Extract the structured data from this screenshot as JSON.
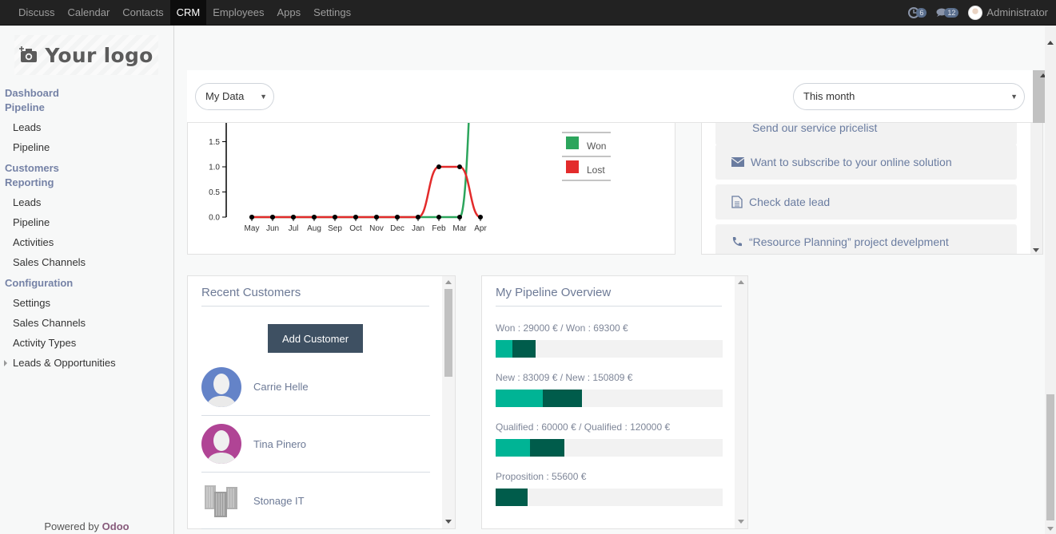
{
  "topbar": {
    "apps": [
      {
        "label": "Discuss",
        "active": false
      },
      {
        "label": "Calendar",
        "active": false
      },
      {
        "label": "Contacts",
        "active": false
      },
      {
        "label": "CRM",
        "active": true
      },
      {
        "label": "Employees",
        "active": false
      },
      {
        "label": "Apps",
        "active": false
      },
      {
        "label": "Settings",
        "active": false
      }
    ],
    "activity_count": "6",
    "message_count": "12",
    "user_name": "Administrator"
  },
  "sidebar": {
    "logo_text": "Your logo",
    "sections": [
      {
        "label": "Dashboard",
        "items": []
      },
      {
        "label": "Pipeline",
        "items": [
          "Leads",
          "Pipeline"
        ]
      },
      {
        "label": "Customers",
        "items": []
      },
      {
        "label": "Reporting",
        "items": [
          "Leads",
          "Pipeline",
          "Activities",
          "Sales Channels"
        ]
      },
      {
        "label": "Configuration",
        "items": [
          "Settings",
          "Sales Channels",
          "Activity Types",
          "Leads & Opportunities"
        ]
      }
    ],
    "powered_by": "Powered by",
    "powered_brand": "Odoo"
  },
  "filters": {
    "scope": "My Data",
    "period": "This month"
  },
  "chart_data": {
    "type": "line",
    "title": "",
    "xlabel": "",
    "ylabel": "",
    "categories": [
      "May",
      "Jun",
      "Jul",
      "Aug",
      "Sep",
      "Oct",
      "Nov",
      "Dec",
      "Jan",
      "Feb",
      "Mar",
      "Apr"
    ],
    "yticks": [
      "0.0",
      "0.5",
      "1.0",
      "1.5"
    ],
    "ylim": [
      0,
      1.8
    ],
    "series": [
      {
        "name": "Won",
        "color": "#2ca55c",
        "values": [
          0,
          0,
          0,
          0,
          0,
          0,
          0,
          0,
          0,
          0,
          0,
          5
        ]
      },
      {
        "name": "Lost",
        "color": "#e32b2b",
        "values": [
          0,
          0,
          0,
          0,
          0,
          0,
          0,
          0,
          0,
          1,
          1,
          0
        ]
      }
    ],
    "legend": "top-right",
    "grid": false
  },
  "activities": [
    {
      "icon": "none",
      "label": "Send our service pricelist"
    },
    {
      "icon": "envelope",
      "label": "Want to subscribe to your online solution"
    },
    {
      "icon": "document",
      "label": "Check date lead"
    },
    {
      "icon": "phone",
      "label": "“Resource Planning” project develpment"
    }
  ],
  "recent_customers": {
    "title": "Recent Customers",
    "add_label": "Add Customer",
    "customers": [
      {
        "name": "Carrie Helle",
        "avatar": "person",
        "color": "#6483c8"
      },
      {
        "name": "Tina Pinero",
        "avatar": "person",
        "color": "#b04495"
      },
      {
        "name": "Stonage IT",
        "avatar": "company",
        "color": "#ffffff"
      }
    ]
  },
  "pipeline_overview": {
    "title": "My Pipeline Overview",
    "colors": {
      "mine": "#00b495",
      "total": "#005c4b"
    },
    "rows": [
      {
        "label": "Won : 29000 € / Won : 69300 €",
        "mine": 29000,
        "total": 69300,
        "mine_pct": 7.3,
        "total_pct": 17.5
      },
      {
        "label": "New : 83009 € / New : 150809 €",
        "mine": 83009,
        "total": 150809,
        "mine_pct": 20.9,
        "total_pct": 38.0
      },
      {
        "label": "Qualified : 60000 € / Qualified : 120000 €",
        "mine": 60000,
        "total": 120000,
        "mine_pct": 15.1,
        "total_pct": 30.3
      },
      {
        "label": "Proposition : 55600 €",
        "mine": 0,
        "total": 55600,
        "mine_pct": 0,
        "total_pct": 14.0
      }
    ]
  }
}
